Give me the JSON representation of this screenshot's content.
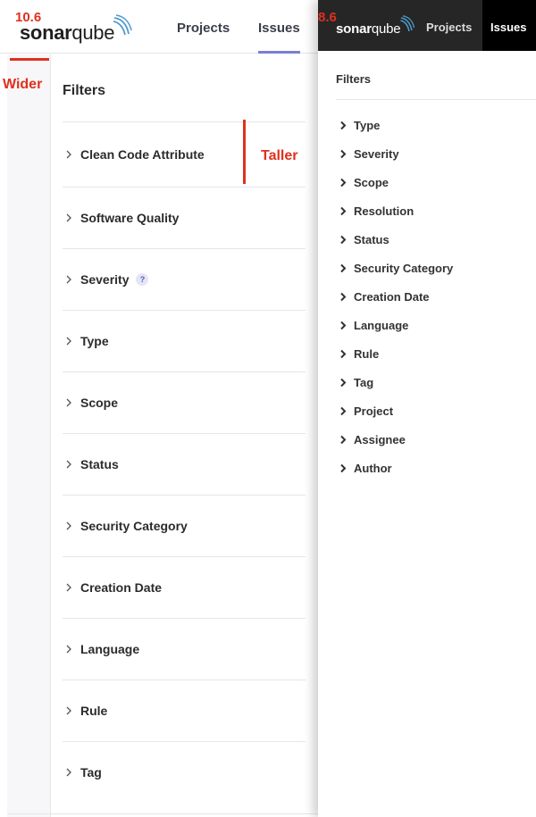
{
  "left_panel": {
    "version_label": "10.6",
    "logo": {
      "text_bold": "sonar",
      "text_light": "qube"
    },
    "nav": {
      "projects": "Projects",
      "issues": "Issues"
    },
    "filters_title": "Filters",
    "facets": [
      {
        "label": "Clean Code Attribute",
        "help": false
      },
      {
        "label": "Software Quality",
        "help": false
      },
      {
        "label": "Severity",
        "help": true,
        "help_text": "?"
      },
      {
        "label": "Type",
        "help": false
      },
      {
        "label": "Scope",
        "help": false
      },
      {
        "label": "Status",
        "help": false
      },
      {
        "label": "Security Category",
        "help": false
      },
      {
        "label": "Creation Date",
        "help": false
      },
      {
        "label": "Language",
        "help": false
      },
      {
        "label": "Rule",
        "help": false
      },
      {
        "label": "Tag",
        "help": false
      }
    ]
  },
  "annotations": {
    "wider": "Wider",
    "taller": "Taller",
    "color": "#e0301e"
  },
  "right_panel": {
    "version_label": "8.6",
    "logo": {
      "text_bold": "sonar",
      "text_light": "qube"
    },
    "nav": {
      "projects": "Projects",
      "issues": "Issues"
    },
    "filters_title": "Filters",
    "facets": [
      "Type",
      "Severity",
      "Scope",
      "Resolution",
      "Status",
      "Security Category",
      "Creation Date",
      "Language",
      "Rule",
      "Tag",
      "Project",
      "Assignee",
      "Author"
    ]
  },
  "colors": {
    "accent": "#7a7fd3",
    "dark_header": "#262626",
    "annotation_red": "#e0301e"
  }
}
